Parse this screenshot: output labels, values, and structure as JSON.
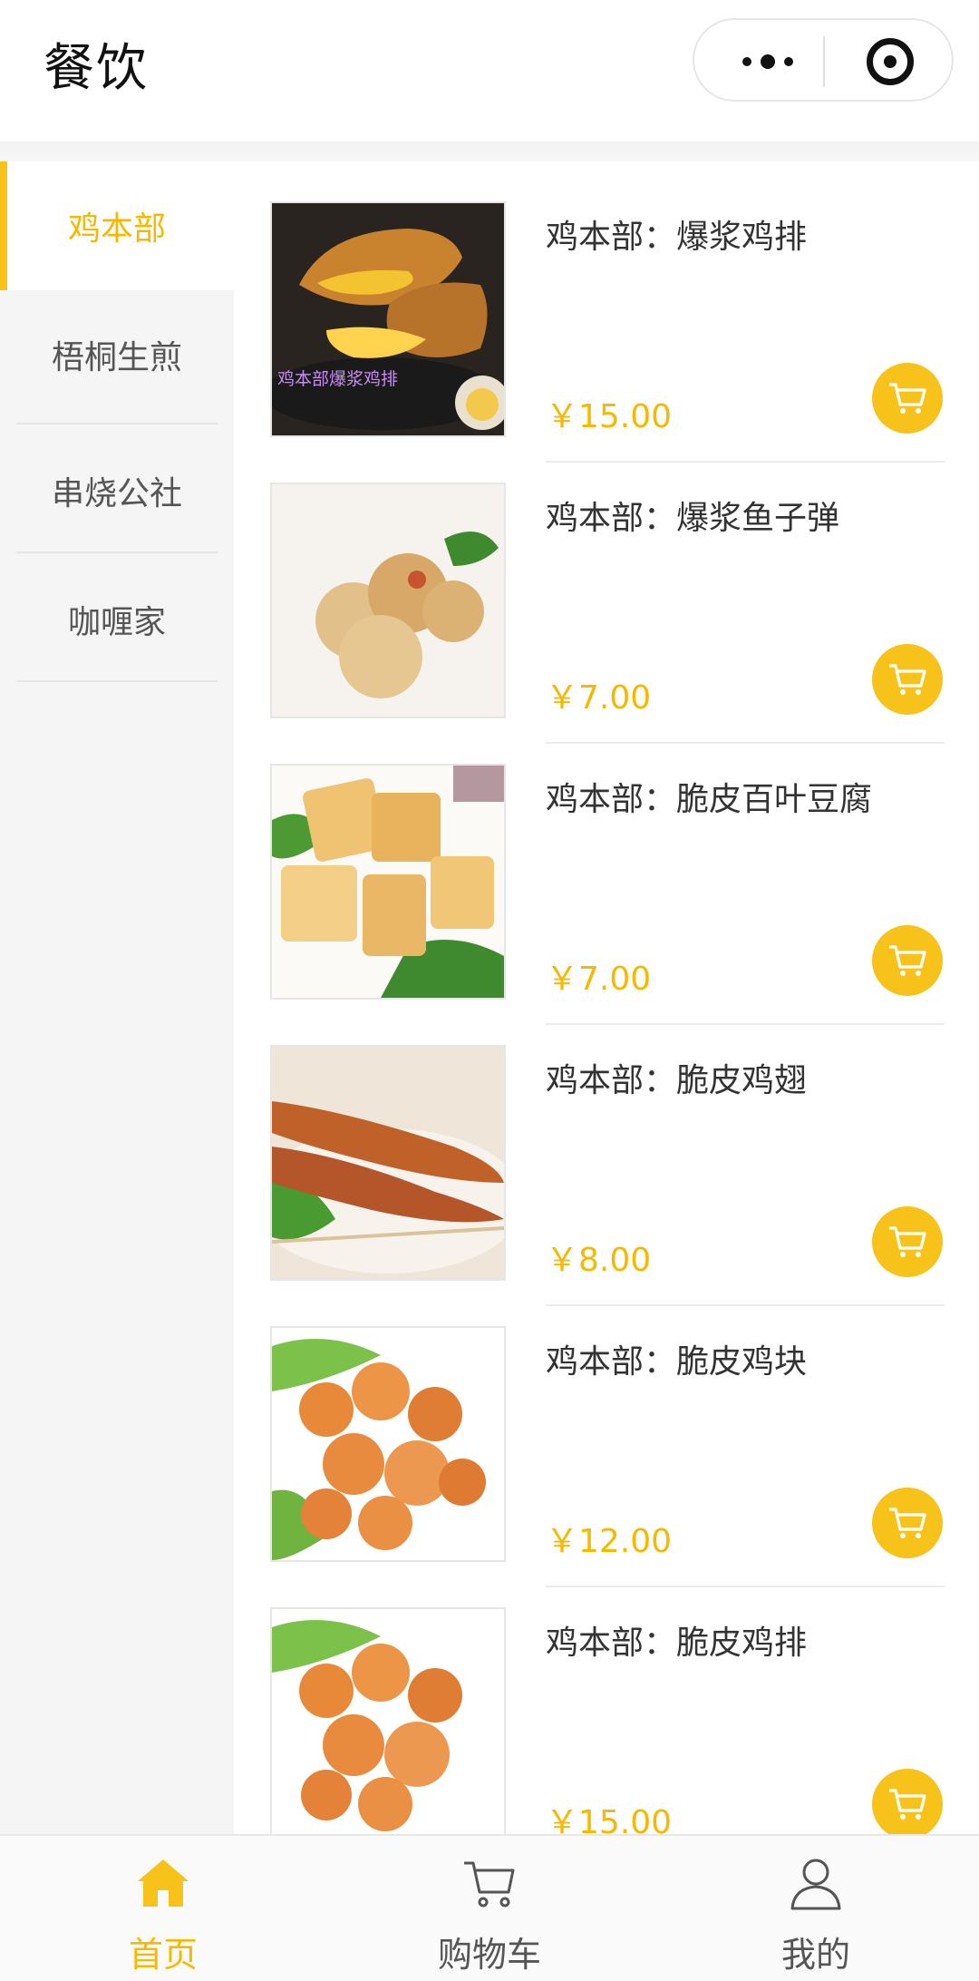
{
  "header": {
    "title": "餐饮"
  },
  "colors": {
    "accent": "#f7c21a",
    "price": "#f7b800",
    "sidebar_bg": "#f5f5f5"
  },
  "sidebar": {
    "items": [
      {
        "label": "鸡本部",
        "active": true
      },
      {
        "label": "梧桐生煎",
        "active": false
      },
      {
        "label": "串烧公社",
        "active": false
      },
      {
        "label": "咖喱家",
        "active": false
      }
    ]
  },
  "products": [
    {
      "name": "鸡本部：爆浆鸡排",
      "price": "￥15.00",
      "image_caption": "鸡本部爆浆鸡排"
    },
    {
      "name": "鸡本部：爆浆鱼子弹",
      "price": "￥7.00"
    },
    {
      "name": "鸡本部：脆皮百叶豆腐",
      "price": "￥7.00"
    },
    {
      "name": "鸡本部：脆皮鸡翅",
      "price": "￥8.00"
    },
    {
      "name": "鸡本部：脆皮鸡块",
      "price": "￥12.00"
    },
    {
      "name": "鸡本部：脆皮鸡排",
      "price": "￥15.00"
    }
  ],
  "tabbar": {
    "tabs": [
      {
        "label": "首页",
        "icon": "home-icon",
        "active": true
      },
      {
        "label": "购物车",
        "icon": "cart-icon",
        "active": false
      },
      {
        "label": "我的",
        "icon": "user-icon",
        "active": false
      }
    ]
  }
}
